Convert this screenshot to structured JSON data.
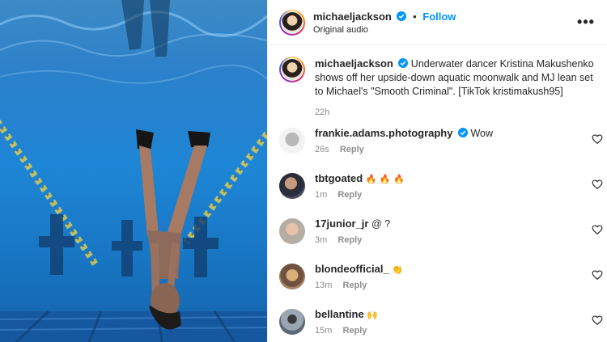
{
  "post": {
    "author": "michaeljackson",
    "follow_label": "Follow",
    "audio": "Original audio",
    "more_label": "•••",
    "caption_author": "michaeljackson",
    "caption_text": "Underwater dancer Kristina Makushenko shows off her upside-down aquatic moonwalk and MJ lean set to Michael's \"Smooth Criminal\". [TikTok kristimakush95]",
    "caption_time": "22h",
    "verified": true
  },
  "comments": [
    {
      "username": "frankie.adams.photography",
      "verified": true,
      "text": "Wow",
      "time": "26s",
      "reply_label": "Reply",
      "avatar_color": "#d9d9d9"
    },
    {
      "username": "tbtgoated",
      "verified": false,
      "text": "🔥 🔥 🔥",
      "time": "1m",
      "reply_label": "Reply",
      "avatar_color": "#3a3a46"
    },
    {
      "username": "17junior_jr",
      "verified": false,
      "text": "@ ?",
      "time": "3m",
      "reply_label": "Reply",
      "avatar_color": "#c9c3bb"
    },
    {
      "username": "blondeofficial_",
      "verified": false,
      "text": "👏",
      "time": "13m",
      "reply_label": "Reply",
      "avatar_color": "#8a6a52"
    },
    {
      "username": "bellantine",
      "verified": false,
      "text": "🙌",
      "time": "15m",
      "reply_label": "Reply",
      "avatar_color": "#6b7a8a"
    }
  ],
  "icons": {
    "verified": "verified-badge-icon",
    "heart": "heart-outline-icon",
    "more": "more-horizontal-icon"
  },
  "colors": {
    "accent": "#0095f6",
    "muted": "#8e8e8e",
    "text": "#262626"
  }
}
